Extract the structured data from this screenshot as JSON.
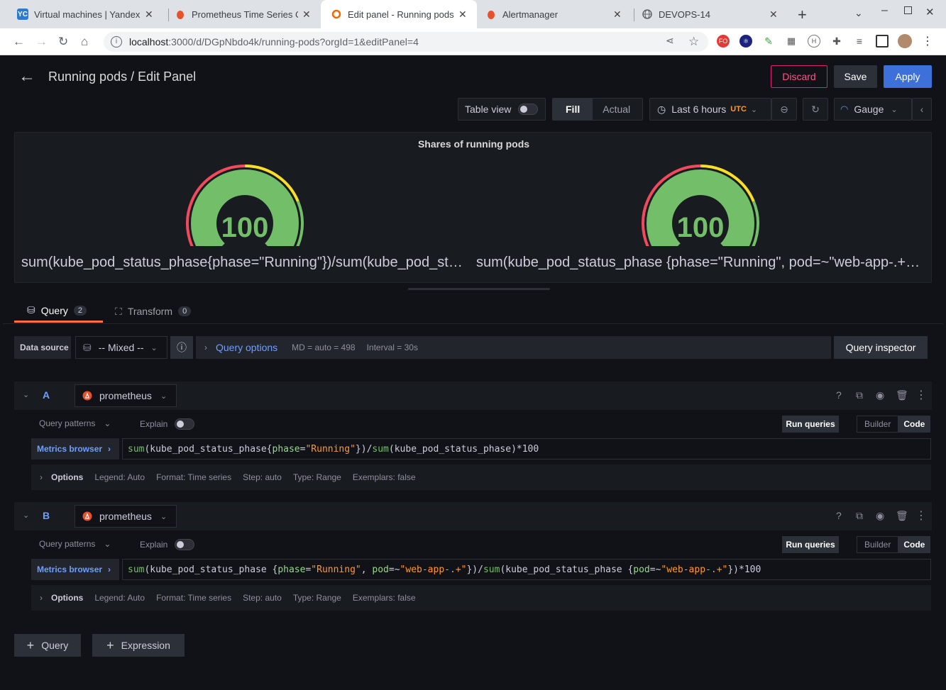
{
  "browser": {
    "tabs": [
      {
        "title": "Virtual machines | Yandex",
        "icon": "YC",
        "color": "#2a7bd6"
      },
      {
        "title": "Prometheus Time Series C",
        "icon": "",
        "color": "#e6522c"
      },
      {
        "title": "Edit panel - Running pods",
        "icon": "",
        "color": "#f46800"
      },
      {
        "title": "Alertmanager",
        "icon": "",
        "color": "#e6522c"
      },
      {
        "title": "DEVOPS-14",
        "icon": "",
        "color": "#5f6368"
      }
    ],
    "url_host": "localhost",
    "url_rest": ":3000/d/DGpNbdo4k/running-pods?orgId=1&editPanel=4"
  },
  "header": {
    "title": "Running pods / Edit Panel",
    "discard": "Discard",
    "save": "Save",
    "apply": "Apply"
  },
  "toolbar": {
    "table_view": "Table view",
    "fill": "Fill",
    "actual": "Actual",
    "time_range": "Last 6 hours",
    "tz": "UTC",
    "viz": "Gauge"
  },
  "panel": {
    "title": "Shares of running pods",
    "gauges": [
      {
        "value": "100",
        "fraction": 1.0,
        "label": "sum(kube_pod_status_phase{phase=\"Running\"})/sum(kube_pod_status_phase)*100"
      },
      {
        "value": "100",
        "fraction": 1.0,
        "label": "sum(kube_pod_status_phase {phase=\"Running\", pod=~\"web-app-.+\"})/sum(kube_pod_status_phase {pod=~\"web-app-.+\"})*100"
      }
    ],
    "colors": {
      "green": "#73bf69",
      "yellow": "#fade2a",
      "red": "#f2495c"
    }
  },
  "query_tabs": {
    "query": "Query",
    "query_count": "2",
    "transform": "Transform",
    "transform_count": "0"
  },
  "datasource_row": {
    "label": "Data source",
    "value": "-- Mixed --",
    "query_options": "Query options",
    "md": "MD = auto = 498",
    "interval": "Interval = 30s",
    "inspector": "Query inspector"
  },
  "queries": [
    {
      "ref": "A",
      "datasource": "prometheus",
      "patterns": "Query patterns",
      "explain": "Explain",
      "run": "Run queries",
      "builder": "Builder",
      "code": "Code",
      "metrics_browser": "Metrics browser",
      "options_label": "Options",
      "legend": "Legend: Auto",
      "format": "Format: Time series",
      "step": "Step: auto",
      "type": "Type: Range",
      "exemplars": "Exemplars: false"
    },
    {
      "ref": "B",
      "datasource": "prometheus",
      "patterns": "Query patterns",
      "explain": "Explain",
      "run": "Run queries",
      "builder": "Builder",
      "code": "Code",
      "metrics_browser": "Metrics browser",
      "options_label": "Options",
      "legend": "Legend: Auto",
      "format": "Format: Time series",
      "step": "Step: auto",
      "type": "Type: Range",
      "exemplars": "Exemplars: false"
    }
  ],
  "code_tokens": {
    "sum": "sum",
    "open": "(kube_pod_status_phase{",
    "open_sp": "(kube_pod_status_phase {",
    "phase": "phase",
    "eq": "=",
    "running": "\"Running\"",
    "close_div": "})/",
    "tail_a": "(kube_pod_status_phase)*100",
    "comma": ", ",
    "pod": "pod",
    "re": "=~",
    "webapp": "\"web-app-.+\"",
    "tail_b": "})*100"
  },
  "footer": {
    "add_query": "Query",
    "add_expression": "Expression"
  }
}
